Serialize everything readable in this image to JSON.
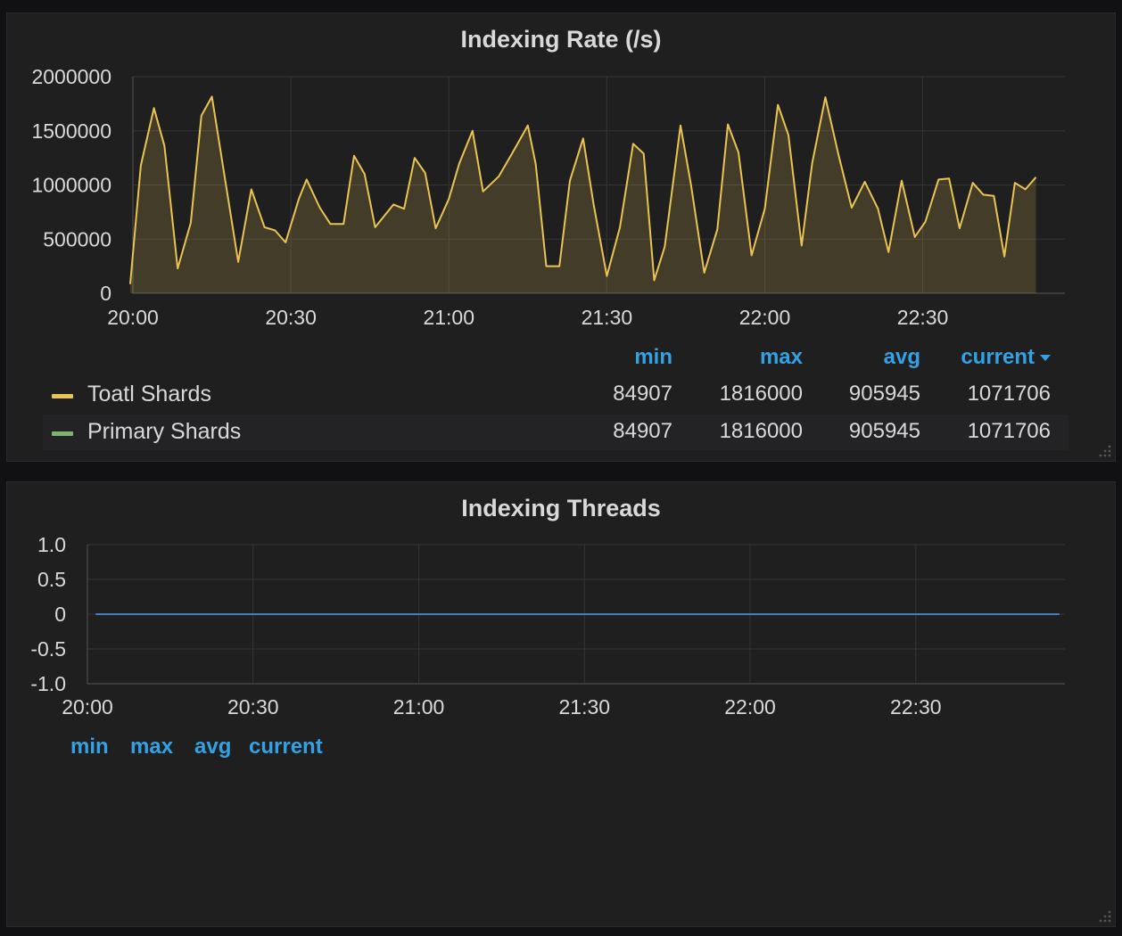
{
  "panels": {
    "rate": {
      "title": "Indexing Rate (/s)",
      "legend": {
        "headers": {
          "min": "min",
          "max": "max",
          "avg": "avg",
          "current": "current"
        },
        "series": [
          {
            "name": "Toatl Shards",
            "color": "#eac453",
            "min": "84907",
            "max": "1816000",
            "avg": "905945",
            "current": "1071706"
          },
          {
            "name": "Primary Shards",
            "color": "#7eb26d",
            "min": "84907",
            "max": "1816000",
            "avg": "905945",
            "current": "1071706"
          }
        ]
      }
    },
    "threads": {
      "title": "Indexing Threads",
      "legend": {
        "headers": {
          "min": "min",
          "max": "max",
          "avg": "avg",
          "current": "current"
        }
      }
    }
  },
  "chart_data": [
    {
      "type": "area",
      "title": "Indexing Rate (/s)",
      "x_tick_labels": [
        "20:00",
        "20:30",
        "21:00",
        "21:30",
        "22:00",
        "22:30"
      ],
      "y_tick_labels": [
        "0",
        "500000",
        "1000000",
        "1500000",
        "2000000"
      ],
      "ylim": [
        0,
        2000000
      ],
      "xlim_minutes": [
        0,
        177
      ],
      "grid": true,
      "legend": "bottom",
      "series": [
        {
          "name": "Toatl Shards",
          "color": "#eac453",
          "x_minutes": [
            -0.5,
            1.5,
            4,
            6,
            8.5,
            11,
            13,
            15,
            18,
            20,
            22.5,
            25,
            27,
            29,
            31.5,
            33,
            35.5,
            37.5,
            40,
            42,
            44,
            46,
            49.5,
            51.5,
            53.5,
            55.5,
            57.5,
            60,
            62,
            64.5,
            66.5,
            69.5,
            72,
            75,
            76.5,
            78.5,
            81,
            83,
            85.5,
            87.5,
            90,
            92.5,
            95,
            97,
            99,
            101,
            104,
            106,
            108.5,
            111,
            113,
            115,
            117.5,
            120,
            122.5,
            124.5,
            127,
            129,
            131.5,
            134,
            136.5,
            139,
            141.5,
            143.5,
            146,
            148.5,
            150.5,
            153,
            155,
            157,
            159.5,
            161.5,
            163.5,
            165.5,
            167.5,
            169.5,
            171.5,
            174,
            176.5
          ],
          "values": [
            84907,
            1180000,
            1710000,
            1360000,
            230000,
            650000,
            1640000,
            1816000,
            900000,
            290000,
            960000,
            610000,
            580000,
            470000,
            870000,
            1050000,
            790000,
            640000,
            640000,
            1270000,
            1100000,
            610000,
            820000,
            780000,
            1250000,
            1110000,
            600000,
            870000,
            1200000,
            1500000,
            940000,
            1080000,
            1290000,
            1550000,
            1190000,
            250000,
            250000,
            1040000,
            1430000,
            820000,
            160000,
            610000,
            1380000,
            1290000,
            120000,
            430000,
            1550000,
            1000000,
            190000,
            590000,
            1560000,
            1300000,
            350000,
            780000,
            1740000,
            1460000,
            440000,
            1200000,
            1810000,
            1280000,
            790000,
            1030000,
            780000,
            380000,
            1040000,
            520000,
            660000,
            1050000,
            1060000,
            600000,
            1020000,
            910000,
            900000,
            340000,
            1020000,
            960000,
            1071706
          ]
        },
        {
          "name": "Primary Shards",
          "color": "#7eb26d"
        }
      ]
    },
    {
      "type": "line",
      "title": "Indexing Threads",
      "x_tick_labels": [
        "20:00",
        "20:30",
        "21:00",
        "21:30",
        "22:00",
        "22:30"
      ],
      "y_tick_labels": [
        "1.0",
        "0.5",
        "0",
        "-0.5",
        "-1.0"
      ],
      "ylim": [
        -1,
        1
      ],
      "xlim_minutes": [
        0,
        177
      ],
      "grid": true,
      "series": [
        {
          "color": "#447ebc",
          "x_minutes": [
            1.5,
            176
          ],
          "values": [
            0,
            0
          ]
        }
      ]
    }
  ]
}
